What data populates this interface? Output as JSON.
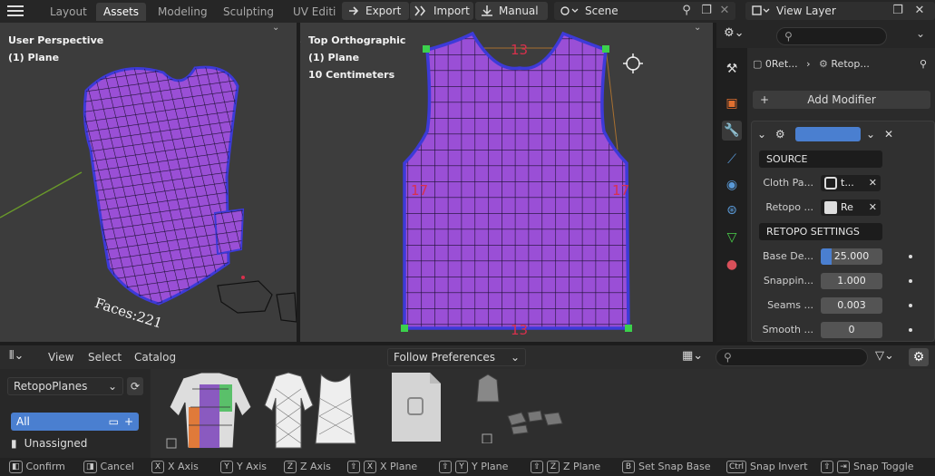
{
  "topbar": {
    "tabs": [
      "Layout",
      "Assets",
      "Modeling",
      "Sculpting",
      "UV Editi"
    ],
    "active_tab": "Assets",
    "export_label": "Export",
    "import_label": "Import",
    "manual_label": "Manual",
    "scene_label": "Scene",
    "view_layer_label": "View Layer"
  },
  "viewport_left": {
    "line1": "User Perspective",
    "line2": "(1) Plane",
    "faces_text": "Faces:221"
  },
  "viewport_mid": {
    "line1": "Top Orthographic",
    "line2": "(1) Plane",
    "line3": "10 Centimeters",
    "edge_counts": {
      "top": "13",
      "bottom": "13",
      "left": "17",
      "right": "17"
    }
  },
  "properties": {
    "breadcrumb_object": "0Ret...",
    "breadcrumb_modifier": "Retop...",
    "add_modifier": "Add Modifier",
    "source_header": "SOURCE",
    "cloth_label": "Cloth Pa...",
    "cloth_value": "t...",
    "retopo_label": "Retopo ...",
    "retopo_value": "Re",
    "settings_header": "RETOPO SETTINGS",
    "rows": [
      {
        "label": "Base De...",
        "value": "25.000"
      },
      {
        "label": "Snappin...",
        "value": "1.000"
      },
      {
        "label": "Seams ...",
        "value": "0.003"
      },
      {
        "label": "Smooth ...",
        "value": "0"
      }
    ]
  },
  "asset_browser": {
    "menus": [
      "View",
      "Select",
      "Catalog"
    ],
    "import_method": "Follow Preferences",
    "library": "RetopoPlanes",
    "catalog_all": "All",
    "catalog_unassigned": "Unassigned"
  },
  "statusbar": {
    "confirm": "Confirm",
    "cancel": "Cancel",
    "x_axis": "X Axis",
    "y_axis": "Y Axis",
    "z_axis": "Z Axis",
    "x_plane": "X Plane",
    "y_plane": "Y Plane",
    "z_plane": "Z Plane",
    "snap_base": "Set Snap Base",
    "snap_invert": "Snap Invert",
    "snap_toggle": "Snap Toggle",
    "key_x": "X",
    "key_y": "Y",
    "key_z": "Z",
    "key_ctrl": "Ctrl",
    "key_b": "B"
  },
  "colors": {
    "mesh_fill": "#9a4fd6",
    "mesh_edge": "#3d3ad8",
    "grid": "#1a1030",
    "accent_blue": "#4a7fd0",
    "vertex_green": "#3bd14c",
    "edge_count_red": "#d8304c"
  }
}
